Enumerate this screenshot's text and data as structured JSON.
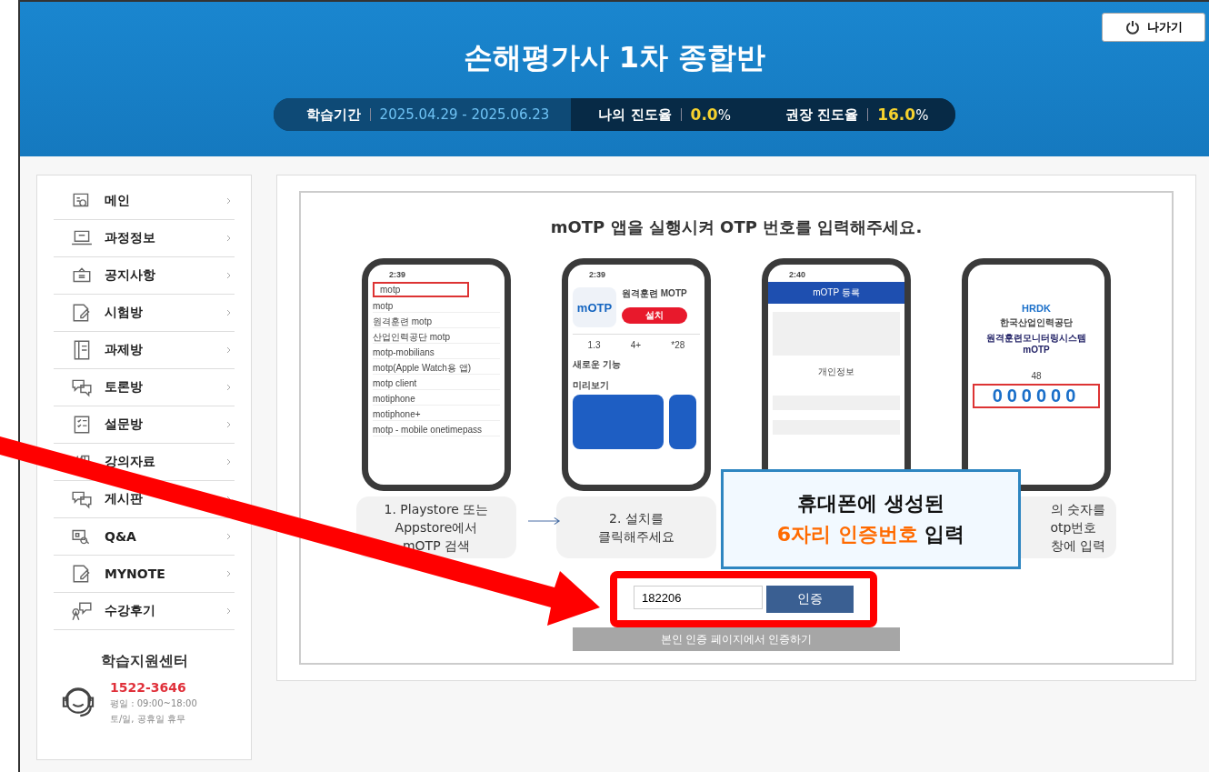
{
  "header": {
    "title": "손해평가사 1차 종합반",
    "exit_label": "나가기",
    "stats": [
      {
        "label": "학습기간",
        "value": "2025.04.29 - 2025.06.23",
        "kind": "period"
      },
      {
        "label": "나의 진도율",
        "value": "0.0",
        "unit": "%",
        "kind": "rate"
      },
      {
        "label": "권장 진도율",
        "value": "16.0",
        "unit": "%",
        "kind": "rate"
      }
    ]
  },
  "sidebar": {
    "items": [
      {
        "label": "메인"
      },
      {
        "label": "과정정보"
      },
      {
        "label": "공지사항"
      },
      {
        "label": "시험방"
      },
      {
        "label": "과제방"
      },
      {
        "label": "토론방"
      },
      {
        "label": "설문방"
      },
      {
        "label": "강의자료"
      },
      {
        "label": "게시판"
      },
      {
        "label": "Q&A"
      },
      {
        "label": "MYNOTE"
      },
      {
        "label": "수강후기"
      }
    ],
    "support": {
      "title": "학습지원센터",
      "phone": "1522-3646",
      "hours": "평일 : 09:00~18:00",
      "holiday": "토/일, 공휴일 휴무"
    }
  },
  "otp": {
    "heading": "mOTP 앱을 실행시켜 OTP 번호를 입력해주세요.",
    "phones": [
      {
        "kind": "search",
        "step": "1. Playstore 또는\nAppstore에서\nmOTP 검색",
        "time": "2:39",
        "query": "motp",
        "results": [
          "motp",
          "원격훈련 motp",
          "산업인력공단 motp",
          "motp-mobilians",
          "motp(Apple Watch용 앱)",
          "motp client",
          "motiphone",
          "motiphone+",
          "motp - mobile onetimepass"
        ]
      },
      {
        "kind": "app",
        "step": "2. 설치를\n클릭해주세요",
        "time": "2:39",
        "logo": "mOTP",
        "app_name": "원격훈련 MOTP",
        "install": "설치",
        "stats": [
          "1.3",
          "4+",
          "*28"
        ],
        "section": "새로운 기능",
        "preview": "미리보기"
      },
      {
        "kind": "form",
        "time": "2:40",
        "bar_title": "mOTP 등록",
        "section": "개인정보"
      },
      {
        "kind": "otp",
        "step": "의 숫자를\notp번호\n창에 입력",
        "brand": "HRDK",
        "org": "한국산업인력공단",
        "system": "원격훈련모니터링시스템 mOTP",
        "timer": "48",
        "code": "000000"
      }
    ],
    "callout": {
      "line1": "휴대폰에 생성된",
      "highlight": "6자리 인증번호",
      "rest": "입력"
    },
    "code_value": "182206",
    "verify_button": "인증",
    "alt_button": "본인 인증 페이지에서 인증하기"
  }
}
